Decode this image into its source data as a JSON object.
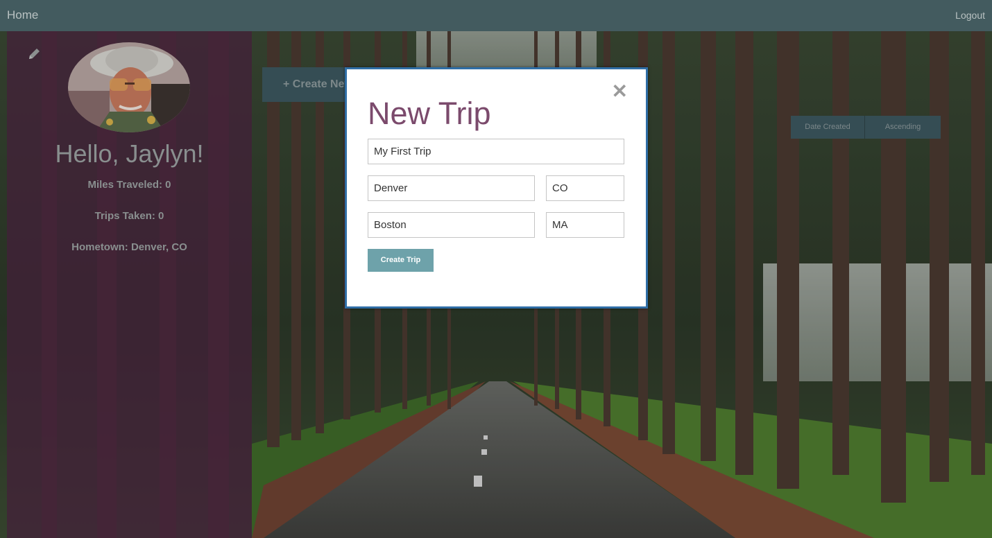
{
  "nav": {
    "home_label": "Home",
    "logout_label": "Logout"
  },
  "profile": {
    "greeting": "Hello, Jaylyn!",
    "miles_traveled": "Miles Traveled: 0",
    "trips_taken": "Trips Taken: 0",
    "hometown": "Hometown: Denver, CO"
  },
  "toolbar": {
    "create_label": "+ Create New Trip",
    "sort_field": "Date Created",
    "sort_order": "Ascending"
  },
  "modal": {
    "title": "New Trip",
    "close_glyph": "✕",
    "trip_name": "My First Trip",
    "origin_city": "Denver",
    "origin_state": "CO",
    "destination_city": "Boston",
    "destination_state": "MA",
    "submit_label": "Create Trip"
  },
  "colors": {
    "navbar": "#435b5f",
    "sidebar": "#4e2442",
    "modal_title": "#7b4a6c",
    "modal_border": "#2f6ea6",
    "submit_button": "#6ea2aa",
    "sort_button": "#3d5860"
  },
  "icons": {
    "edit": "pencil-icon",
    "close": "close-icon"
  }
}
